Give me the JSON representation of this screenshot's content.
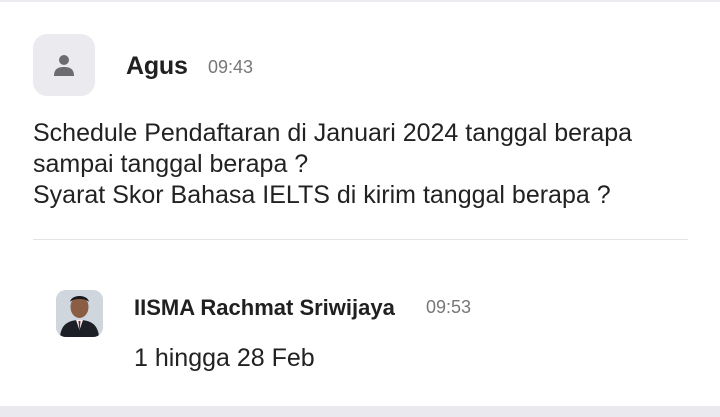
{
  "message": {
    "author": "Agus",
    "time": "09:43",
    "avatar_icon": "person-icon",
    "lines": [
      "Schedule Pendaftaran di Januari 2024 tanggal berapa",
      "sampai tanggal berapa  ?",
      "Syarat Skor Bahasa IELTS di kirim tanggal berapa  ?"
    ]
  },
  "reply": {
    "author": "IISMA Rachmat Sriwijaya",
    "time": "09:53",
    "avatar_icon": "profile-photo",
    "text": "1 hingga 28 Feb"
  },
  "colors": {
    "avatar_bg": "#ebebef",
    "icon": "#6b6b70",
    "muted": "#777777"
  }
}
